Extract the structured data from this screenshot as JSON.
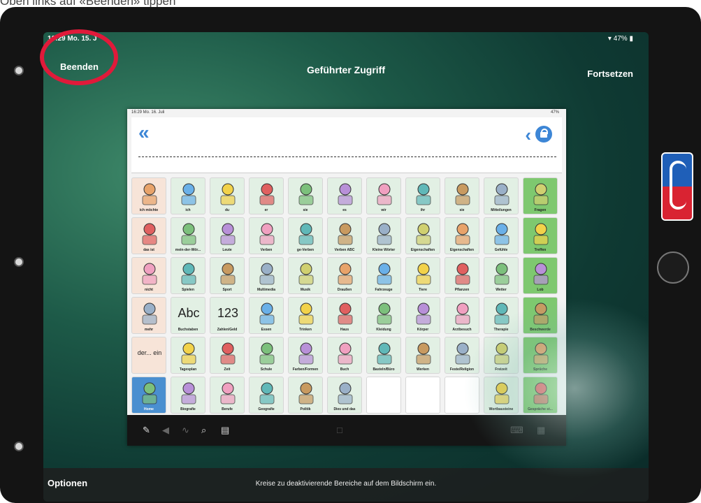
{
  "caption": "Oben links auf «Beenden» tippen",
  "status": {
    "time": "16:29  Mo. 15. J",
    "battery": "47%"
  },
  "nav": {
    "left_button": "Beenden",
    "title": "Geführter Zugriff",
    "right_button": "Fortsetzen"
  },
  "bottom": {
    "options": "Optionen",
    "hint": "Kreise zu deaktivierende Bereiche auf dem Bildschirm ein."
  },
  "inner": {
    "status_left": "16:29  Mo. 16. Juli",
    "status_right": "47%"
  },
  "colors": {
    "accent": "#3d86d6",
    "highlight_circle": "#e01a3a",
    "category_green": "#7ec86f"
  },
  "grid": [
    [
      {
        "label": "ich möchte",
        "color": "peach",
        "icon": "person-raise-hand-icon"
      },
      {
        "label": "ich",
        "color": "mint",
        "icon": "person-self-icon"
      },
      {
        "label": "du",
        "color": "mint",
        "icon": "person-you-icon"
      },
      {
        "label": "er",
        "color": "mint",
        "icon": "person-he-icon"
      },
      {
        "label": "sie",
        "color": "mint",
        "icon": "person-she-icon"
      },
      {
        "label": "es",
        "color": "mint",
        "icon": "child-icon"
      },
      {
        "label": "wir",
        "color": "mint",
        "icon": "people-we-icon"
      },
      {
        "label": "ihr",
        "color": "mint",
        "icon": "people-you-icon"
      },
      {
        "label": "sie",
        "color": "mint",
        "icon": "people-they-icon"
      },
      {
        "label": "Mitteilungen",
        "color": "mint",
        "icon": "speaker-button-icon"
      },
      {
        "label": "Fragen",
        "color": "green",
        "icon": "question-mark-icon"
      }
    ],
    [
      {
        "label": "das ist",
        "color": "peach",
        "icon": "pointing-hand-icon"
      },
      {
        "label": "mein-der-Wör...",
        "color": "mint",
        "icon": "group-icon"
      },
      {
        "label": "Leute",
        "color": "mint",
        "icon": "people-group-icon"
      },
      {
        "label": "Verben",
        "color": "mint",
        "icon": "verbs-icon"
      },
      {
        "label": "ge-Verben",
        "color": "mint",
        "icon": "hourglass-icon"
      },
      {
        "label": "Verben ABC",
        "color": "mint",
        "icon": "abc-icon"
      },
      {
        "label": "Kleine Wörter",
        "color": "mint",
        "icon": "bars-icon"
      },
      {
        "label": "Eigenschaften",
        "color": "mint",
        "icon": "snowflake-icon"
      },
      {
        "label": "Eigenschaften",
        "color": "mint",
        "icon": "snowflake-abc-icon"
      },
      {
        "label": "Gefühle",
        "color": "mint",
        "icon": "feelings-icon"
      },
      {
        "label": "Treffen",
        "color": "green",
        "icon": "meeting-icon"
      }
    ],
    [
      {
        "label": "nicht",
        "color": "peach",
        "icon": "cross-icon"
      },
      {
        "label": "Spielen",
        "color": "mint",
        "icon": "toys-icon"
      },
      {
        "label": "Sport",
        "color": "mint",
        "icon": "sport-icon"
      },
      {
        "label": "Multimedia",
        "color": "mint",
        "icon": "multimedia-icon"
      },
      {
        "label": "Musik",
        "color": "mint",
        "icon": "guitar-icon"
      },
      {
        "label": "Draußen",
        "color": "mint",
        "icon": "house-tree-icon"
      },
      {
        "label": "Fahrzeuge",
        "color": "mint",
        "icon": "vehicles-icon"
      },
      {
        "label": "Tiere",
        "color": "mint",
        "icon": "animals-icon"
      },
      {
        "label": "Pflanzen",
        "color": "mint",
        "icon": "tree-icon"
      },
      {
        "label": "Wetter",
        "color": "mint",
        "icon": "weather-icon"
      },
      {
        "label": "Lob",
        "color": "green",
        "icon": "thumbs-up-icon"
      }
    ],
    [
      {
        "label": "mehr",
        "color": "peach",
        "icon": "more-icon"
      },
      {
        "label": "Buchstaben",
        "color": "mint",
        "icon": "letters-icon",
        "text": "Abc"
      },
      {
        "label": "Zahlen/Geld",
        "color": "mint",
        "icon": "numbers-icon",
        "text": "123"
      },
      {
        "label": "Essen",
        "color": "mint",
        "icon": "plate-icon"
      },
      {
        "label": "Trinken",
        "color": "mint",
        "icon": "drink-icon"
      },
      {
        "label": "Haus",
        "color": "mint",
        "icon": "furniture-icon"
      },
      {
        "label": "Kleidung",
        "color": "mint",
        "icon": "clothes-icon"
      },
      {
        "label": "Körper",
        "color": "mint",
        "icon": "body-icon"
      },
      {
        "label": "Arztbesuch",
        "color": "mint",
        "icon": "doctor-icon"
      },
      {
        "label": "Therapie",
        "color": "mint",
        "icon": "therapy-icon"
      },
      {
        "label": "Beschwerde",
        "color": "green",
        "icon": "thumbs-down-icon"
      }
    ],
    [
      {
        "label": "",
        "color": "peach",
        "icon": "der-ein-icon",
        "text": "der... ein"
      },
      {
        "label": "Tagesplan",
        "color": "mint",
        "icon": "calendar-icon"
      },
      {
        "label": "Zeit",
        "color": "mint",
        "icon": "clock-icon"
      },
      {
        "label": "Schule",
        "color": "mint",
        "icon": "school-icon"
      },
      {
        "label": "Farben/Formen",
        "color": "mint",
        "icon": "colors-icon"
      },
      {
        "label": "Buch",
        "color": "mint",
        "icon": "book-icon"
      },
      {
        "label": "Basteln/Büro",
        "color": "mint",
        "icon": "scissors-icon"
      },
      {
        "label": "Werken",
        "color": "mint",
        "icon": "tools-icon"
      },
      {
        "label": "Feste/Religion",
        "color": "mint",
        "icon": "party-icon"
      },
      {
        "label": "Freizeit",
        "color": "mint",
        "icon": "leisure-icon"
      },
      {
        "label": "Sprüche",
        "color": "green",
        "icon": "speech-bubbles-icon"
      }
    ],
    [
      {
        "label": "Home",
        "color": "home",
        "icon": "home-icon"
      },
      {
        "label": "Biografie",
        "color": "mint",
        "icon": "biography-icon"
      },
      {
        "label": "Berufe",
        "color": "mint",
        "icon": "professions-icon"
      },
      {
        "label": "Geografie",
        "color": "mint",
        "icon": "globe-icon"
      },
      {
        "label": "Politik",
        "color": "mint",
        "icon": "politics-icon"
      },
      {
        "label": "Dies und das",
        "color": "mint",
        "icon": "misc-icon"
      },
      {
        "label": "",
        "color": "empty",
        "icon": ""
      },
      {
        "label": "",
        "color": "empty",
        "icon": ""
      },
      {
        "label": "",
        "color": "empty",
        "icon": ""
      },
      {
        "label": "Wortbausteine",
        "color": "mint",
        "icon": "word-blocks-icon"
      },
      {
        "label": "Gespräche st...",
        "color": "green",
        "icon": "conversation-icon"
      }
    ]
  ]
}
